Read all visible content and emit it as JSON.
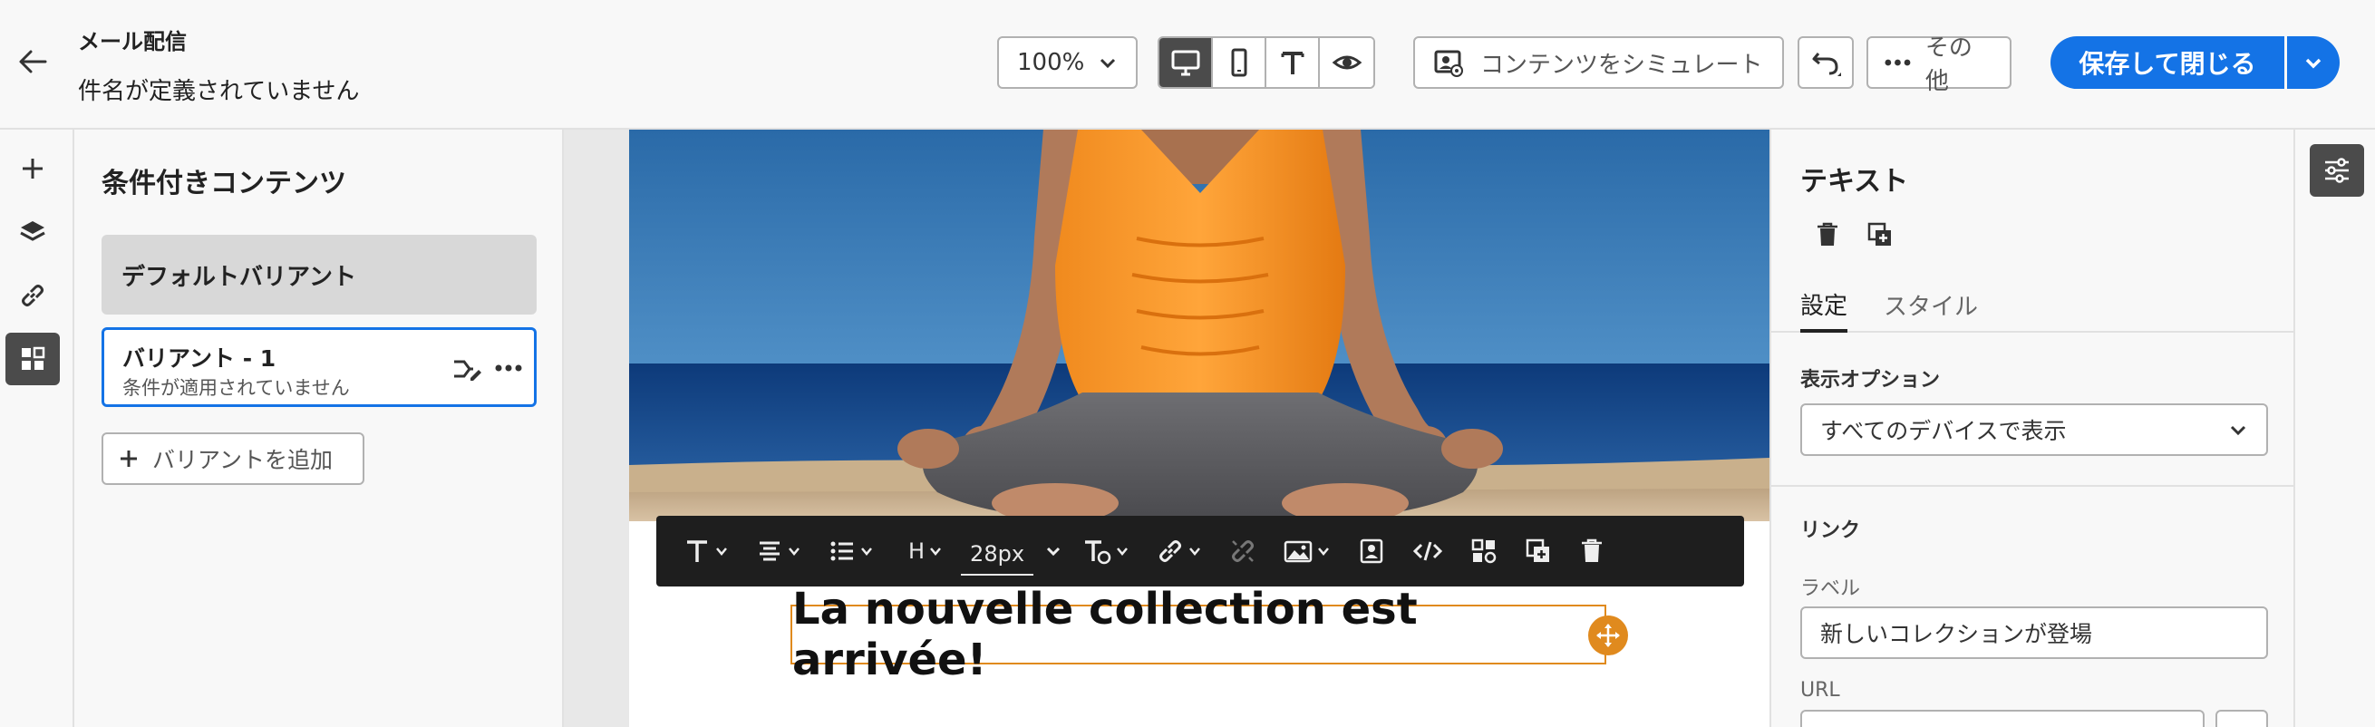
{
  "header": {
    "app_title": "メール配信",
    "subject": "件名が定義されていません",
    "zoom": "100%",
    "simulate_label": "コンテンツをシミュレート",
    "more_label": "その他",
    "save_label": "保存して閉じる",
    "device_buttons": [
      "desktop-icon",
      "mobile-icon",
      "text-icon",
      "eye-icon"
    ],
    "accent_color": "#1473e6"
  },
  "left_rail": {
    "items": [
      "add-icon",
      "layers-icon",
      "link-icon",
      "fragments-icon"
    ],
    "active": "fragments-icon"
  },
  "conditional_panel": {
    "title": "条件付きコンテンツ",
    "default_variant": "デフォルトバリアント",
    "variant_1": {
      "name": "バリアント - 1",
      "condition": "条件が適用されていません"
    },
    "add_variant_label": "バリアントを追加"
  },
  "canvas": {
    "toolbar": {
      "heading_label": "H",
      "font_size": "28px"
    },
    "headline": "La nouvelle collection est arrivée!",
    "selection_color": "#e08a1e"
  },
  "properties": {
    "title": "テキスト",
    "tabs": [
      "設定",
      "スタイル"
    ],
    "display_options_label": "表示オプション",
    "display_options_value": "すべてのデバイスで表示",
    "link_section": "リンク",
    "label_field_label": "ラベル",
    "label_field_value": "新しいコレクションが登場",
    "url_field_label": "URL"
  }
}
